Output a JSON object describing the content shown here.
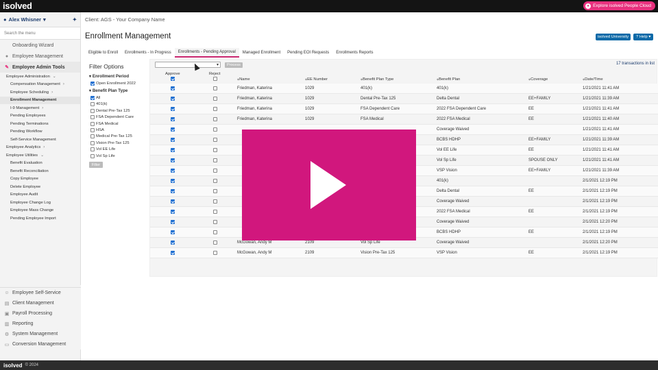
{
  "topbar": {
    "logo": "isolved",
    "explore": "Explore isolved People Cloud"
  },
  "sidebar": {
    "user": "Alex Whisner",
    "search_placeholder": "Search the menu",
    "top_items": [
      {
        "label": "Onboarding Wizard",
        "icon": "none"
      },
      {
        "label": "Employee Management",
        "icon": "people-icon"
      },
      {
        "label": "Employee Admin Tools",
        "icon": "wrench-icon"
      }
    ],
    "sub_items": [
      {
        "label": "Employee Administration",
        "level": 1,
        "chev": "⌄"
      },
      {
        "label": "Compensation Management",
        "level": 2,
        "chev": "›"
      },
      {
        "label": "Employee Scheduling",
        "level": 2,
        "chev": "›"
      },
      {
        "label": "Enrollment Management",
        "level": 2,
        "chev": "",
        "active": true
      },
      {
        "label": "I-9 Management",
        "level": 2,
        "chev": "›"
      },
      {
        "label": "Pending Employees",
        "level": 2,
        "chev": ""
      },
      {
        "label": "Pending Terminations",
        "level": 2,
        "chev": ""
      },
      {
        "label": "Pending Workflow",
        "level": 2,
        "chev": ""
      },
      {
        "label": "Self-Service Management",
        "level": 2,
        "chev": ""
      },
      {
        "label": "Employee Analytics",
        "level": 1,
        "chev": "›"
      },
      {
        "label": "Employee Utilities",
        "level": 1,
        "chev": "⌄"
      },
      {
        "label": "Benefit Evaluation",
        "level": 2,
        "chev": ""
      },
      {
        "label": "Benefit Reconciliation",
        "level": 2,
        "chev": ""
      },
      {
        "label": "Copy Employee",
        "level": 2,
        "chev": ""
      },
      {
        "label": "Delete Employee",
        "level": 2,
        "chev": ""
      },
      {
        "label": "Employee Audit",
        "level": 2,
        "chev": ""
      },
      {
        "label": "Employee Change Log",
        "level": 2,
        "chev": ""
      },
      {
        "label": "Employee Mass Change",
        "level": 2,
        "chev": ""
      },
      {
        "label": "Pending Employee Import",
        "level": 2,
        "chev": ""
      }
    ],
    "bottom_items": [
      {
        "label": "Employee Self-Service",
        "icon": "person-icon",
        "glyph": "☺"
      },
      {
        "label": "Client Management",
        "icon": "building-icon",
        "glyph": "▤"
      },
      {
        "label": "Payroll Processing",
        "icon": "payroll-icon",
        "glyph": "▣"
      },
      {
        "label": "Reporting",
        "icon": "report-icon",
        "glyph": "▥"
      },
      {
        "label": "System Management",
        "icon": "gear-icon",
        "glyph": "⚙"
      },
      {
        "label": "Conversion Management",
        "icon": "conversion-icon",
        "glyph": "▭"
      }
    ]
  },
  "main": {
    "client": "Client: AGS - Your Company Name",
    "title": "Enrollment Management",
    "univ": "isolved University",
    "help": "Help",
    "tabs": [
      {
        "label": "Eligible to Enroll"
      },
      {
        "label": "Enrollments - In Progress"
      },
      {
        "label": "Enrollments - Pending Approval",
        "active": true
      },
      {
        "label": "Managed Enrollment"
      },
      {
        "label": "Pending EOI Requests"
      },
      {
        "label": "Enrollments Reports"
      }
    ]
  },
  "filter": {
    "heading": "Filter Options",
    "period_label": "Enrollment Period",
    "period_items": [
      {
        "label": "Open Enrollment 2022",
        "checked": true
      }
    ],
    "type_label": "Benefit Plan Type",
    "type_items": [
      {
        "label": "All",
        "checked": true
      },
      {
        "label": "401(k)",
        "checked": false
      },
      {
        "label": "Dental Pre-Tax 125",
        "checked": false
      },
      {
        "label": "FSA Dependent Care",
        "checked": false
      },
      {
        "label": "FSA Medical",
        "checked": false
      },
      {
        "label": "HSA",
        "checked": false
      },
      {
        "label": "Medical Pre-Tax 125",
        "checked": false
      },
      {
        "label": "Vision Pre-Tax 125",
        "checked": false
      },
      {
        "label": "Vol EE Life",
        "checked": false
      },
      {
        "label": "Vol Sp Life",
        "checked": false
      }
    ],
    "button": "Filter"
  },
  "grid": {
    "process": "Process",
    "count": "17 transactions in list",
    "headers": {
      "approve": "Approve",
      "reject": "Reject",
      "name": "Name",
      "ee": "EE Number",
      "type": "Benefit Plan Type",
      "plan": "Benefit Plan",
      "coverage": "Coverage",
      "date": "Date/Time"
    },
    "rows": [
      {
        "name": "Friedman, Katerina",
        "ee": "1029",
        "type": "401(k)",
        "plan": "401(k)",
        "coverage": "",
        "date": "1/21/2021 11:41 AM"
      },
      {
        "name": "Friedman, Katerina",
        "ee": "1029",
        "type": "Dental Pre-Tax 125",
        "plan": "Delta Dental",
        "coverage": "EE+FAMILY",
        "date": "1/21/2021 11:39 AM"
      },
      {
        "name": "Friedman, Katerina",
        "ee": "1029",
        "type": "FSA Dependent Care",
        "plan": "2022 FSA Dependent Care",
        "coverage": "EE",
        "date": "1/21/2021 11:41 AM"
      },
      {
        "name": "Friedman, Katerina",
        "ee": "1029",
        "type": "FSA Medical",
        "plan": "2022 FSA Medical",
        "coverage": "EE",
        "date": "1/21/2021 11:40 AM"
      },
      {
        "name": "",
        "ee": "",
        "type": "",
        "plan": "Coverage Waived",
        "coverage": "",
        "date": "1/21/2021 11:41 AM"
      },
      {
        "name": "",
        "ee": "",
        "type": "",
        "plan": "BCBS HDHP",
        "coverage": "EE+FAMILY",
        "date": "1/21/2021 11:39 AM"
      },
      {
        "name": "",
        "ee": "",
        "type": "",
        "plan": "Vol EE Life",
        "coverage": "EE",
        "date": "1/21/2021 11:41 AM"
      },
      {
        "name": "",
        "ee": "",
        "type": "",
        "plan": "Vol Sp Life",
        "coverage": "SPOUSE ONLY",
        "date": "1/21/2021 11:41 AM"
      },
      {
        "name": "",
        "ee": "",
        "type": "",
        "plan": "VSP Vision",
        "coverage": "EE+FAMILY",
        "date": "1/21/2021 11:39 AM"
      },
      {
        "name": "",
        "ee": "",
        "type": "",
        "plan": "401(k)",
        "coverage": "",
        "date": "2/1/2021 12:19 PM"
      },
      {
        "name": "",
        "ee": "",
        "type": "",
        "plan": "Delta Dental",
        "coverage": "EE",
        "date": "2/1/2021 12:19 PM"
      },
      {
        "name": "",
        "ee": "",
        "type": "",
        "plan": "Coverage Waived",
        "coverage": "",
        "date": "2/1/2021 12:19 PM"
      },
      {
        "name": "",
        "ee": "",
        "type": "",
        "plan": "2022 FSA Medical",
        "coverage": "EE",
        "date": "2/1/2021 12:19 PM"
      },
      {
        "name": "",
        "ee": "",
        "type": "",
        "plan": "Coverage Waived",
        "coverage": "",
        "date": "2/1/2021 12:20 PM"
      },
      {
        "name": "",
        "ee": "",
        "type": "",
        "plan": "BCBS HDHP",
        "coverage": "EE",
        "date": "2/1/2021 12:19 PM"
      },
      {
        "name": "McGowan, Andy M",
        "ee": "2109",
        "type": "Vol Sp Life",
        "plan": "Coverage Waived",
        "coverage": "",
        "date": "2/1/2021 12:20 PM"
      },
      {
        "name": "McGowan, Andy M",
        "ee": "2109",
        "type": "Vision Pre-Tax 125",
        "plan": "VSP Vision",
        "coverage": "EE",
        "date": "2/1/2021 12:19 PM"
      }
    ]
  },
  "footer": {
    "brand": "isolved",
    "copy": "© 2024"
  }
}
